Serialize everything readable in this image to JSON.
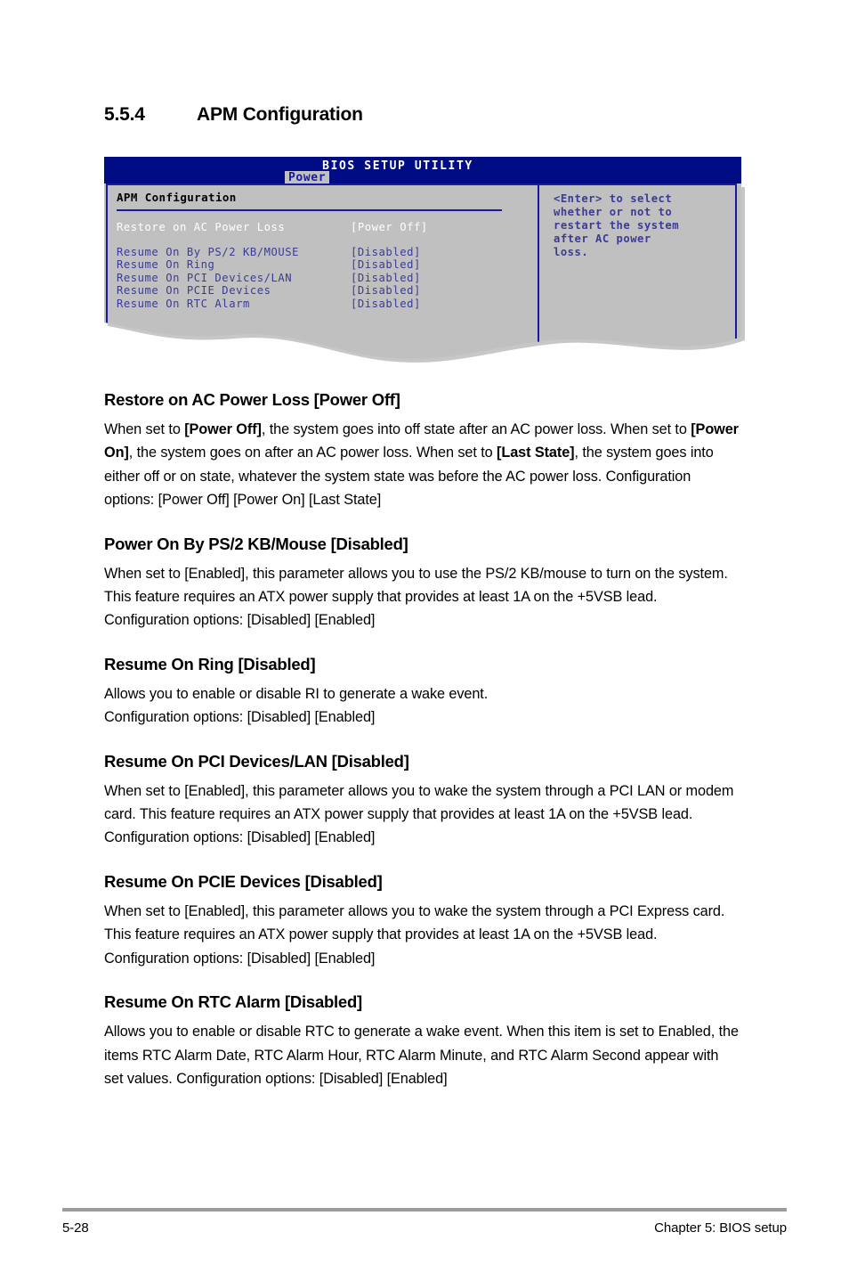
{
  "section": {
    "number": "5.5.4",
    "title": "APM Configuration"
  },
  "bios_screen": {
    "title": "BIOS SETUP UTILITY",
    "active_tab": "Power",
    "panel_heading": "APM Configuration",
    "rows": [
      {
        "label": "Restore on AC Power Loss",
        "value": "[Power Off]",
        "selected": true
      },
      {
        "label": "Resume On By PS/2 KB/MOUSE",
        "value": "[Disabled]",
        "selected": false
      },
      {
        "label": "Resume On Ring",
        "value": "[Disabled]",
        "selected": false
      },
      {
        "label": "Resume On PCI Devices/LAN",
        "value": "[Disabled]",
        "selected": false
      },
      {
        "label": "Resume On PCIE Devices",
        "value": "[Disabled]",
        "selected": false
      },
      {
        "label": "Resume On RTC Alarm",
        "value": "[Disabled]",
        "selected": false
      }
    ],
    "help_lines": [
      "<Enter> to select",
      "whether or not to",
      "restart the system",
      "after AC power",
      "loss."
    ],
    "colors": {
      "titlebar": "#000C83",
      "panel_bg": "#C0C0C0",
      "border": "#1A1AA0",
      "item_text": "#3B3B96",
      "selected_text": "#FFFFFF"
    }
  },
  "items": [
    {
      "heading": "Restore on AC Power Loss [Power Off]",
      "body_prefix": "When set to ",
      "body_html_segments": [
        {
          "text": "When set to ",
          "bold": false
        },
        {
          "text": "[Power Off]",
          "bold": true
        },
        {
          "text": ", the system goes into off state after an AC power loss. When set to ",
          "bold": false
        },
        {
          "text": "[Power On]",
          "bold": true
        },
        {
          "text": ", the system goes on after an AC power loss. When set to ",
          "bold": false
        },
        {
          "text": "[Last State]",
          "bold": true
        },
        {
          "text": ", the system goes into either off or on state, whatever the system state was before the AC power loss. Configuration options: [Power Off] [Power On] [Last State]",
          "bold": false
        }
      ]
    },
    {
      "heading": "Power On By PS/2 KB/Mouse [Disabled]",
      "body_html_segments": [
        {
          "text": "When set to [Enabled], this parameter allows you to use the PS/2 KB/mouse to turn on the system. This feature requires an ATX power supply that provides at least 1A on the +5VSB lead. Configuration options: [Disabled] [Enabled]",
          "bold": false
        }
      ]
    },
    {
      "heading": "Resume On Ring [Disabled]",
      "body_html_segments": [
        {
          "text": "Allows you to enable or disable RI to generate a wake event.\nConfiguration options: [Disabled] [Enabled]",
          "bold": false
        }
      ]
    },
    {
      "heading": "Resume On PCI Devices/LAN [Disabled]",
      "body_html_segments": [
        {
          "text": "When set to [Enabled], this parameter allows you to wake the system through a PCI LAN or modem card. This feature requires an ATX power supply that provides at least 1A on the +5VSB lead. Configuration options: [Disabled] [Enabled]",
          "bold": false
        }
      ]
    },
    {
      "heading": "Resume On PCIE Devices [Disabled]",
      "body_html_segments": [
        {
          "text": "When set to [Enabled], this parameter allows you to wake the system through a PCI Express card. This feature requires an ATX power supply that provides at least 1A on the +5VSB lead.  Configuration options: [Disabled] [Enabled]",
          "bold": false
        }
      ]
    },
    {
      "heading": "Resume On RTC Alarm [Disabled]",
      "body_html_segments": [
        {
          "text": "Allows you to enable or disable RTC to generate a wake event. When this item is set to Enabled, the items RTC Alarm Date, RTC Alarm Hour, RTC Alarm Minute, and RTC Alarm Second appear with set values. Configuration options: [Disabled] [Enabled]",
          "bold": false
        }
      ]
    }
  ],
  "footer": {
    "page_number": "5-28",
    "chapter": "Chapter 5: BIOS setup"
  }
}
